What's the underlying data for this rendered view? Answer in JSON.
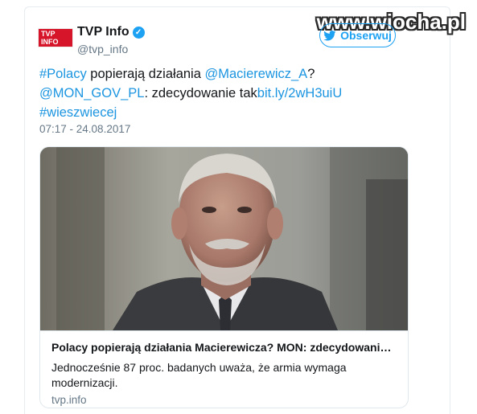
{
  "watermark": "www.wiocha.pl",
  "account": {
    "avatar_text": "TVP INFO",
    "name": "TVP Info",
    "handle": "@tvp_info",
    "verified_icon": "verified-badge-icon"
  },
  "follow_button": {
    "label": "Obserwuj",
    "icon": "twitter-bird-icon"
  },
  "tweet": {
    "hashtag1": "#Polacy",
    "text1": " popierają działania ",
    "mention1": "@Macierewicz_A",
    "text2": "?",
    "mention2": "@MON_GOV_PL",
    "text3": ": zdecydowanie tak",
    "url": "bit.ly/2wH3uiU",
    "hashtag2": "#wieszwiecej",
    "timestamp": "07:17 - 24.08.2017"
  },
  "card": {
    "title": "Polacy popierają działania Macierewicza? MON: zdecydowani…",
    "description": "Jednocześnie 87 proc. badanych uważa, że armia wymaga modernizacji.",
    "domain": "tvp.info"
  },
  "colors": {
    "link": "#1b95e0",
    "accent": "#1da1f2",
    "muted": "#657786"
  }
}
